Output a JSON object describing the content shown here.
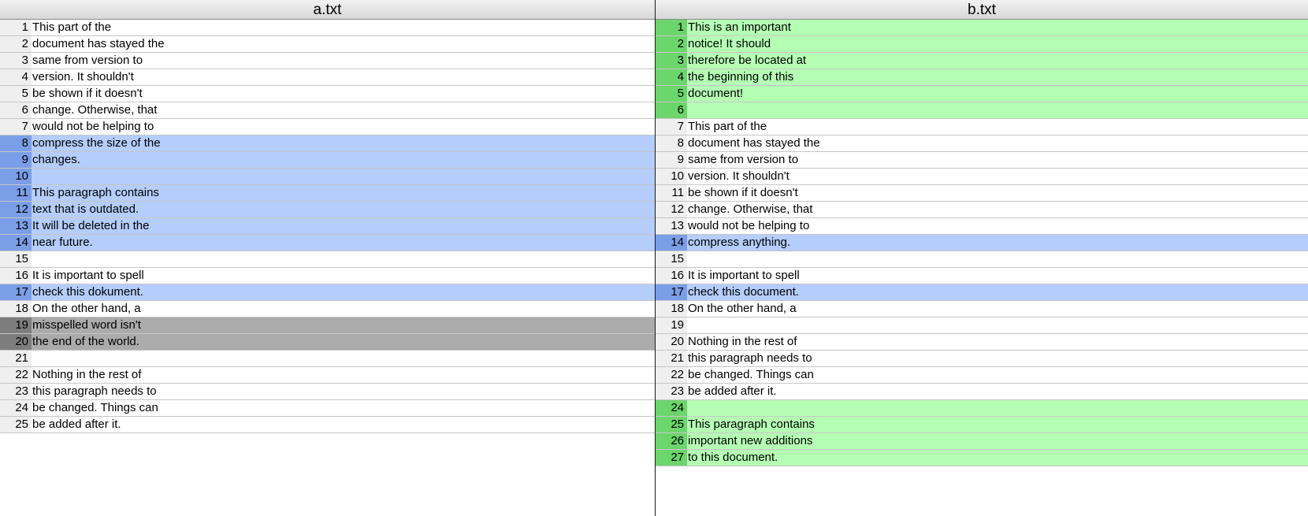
{
  "colors": {
    "changed_text_bg": "#b4cdfb",
    "changed_gutter_bg": "#7b9ee8",
    "added_text_bg": "#b5ffb5",
    "added_gutter_bg": "#6cd56c",
    "deleted_text_bg": "#ababab",
    "deleted_gutter_bg": "#7d7d7d",
    "gutter_bg": "#efefef"
  },
  "left": {
    "title": "a.txt",
    "lines": [
      {
        "n": "1",
        "text": "This part of the",
        "status": "same"
      },
      {
        "n": "2",
        "text": "document has stayed the",
        "status": "same"
      },
      {
        "n": "3",
        "text": "same from version to",
        "status": "same"
      },
      {
        "n": "4",
        "text": "version. It shouldn't",
        "status": "same"
      },
      {
        "n": "5",
        "text": "be shown if it doesn't",
        "status": "same"
      },
      {
        "n": "6",
        "text": "change. Otherwise, that",
        "status": "same"
      },
      {
        "n": "7",
        "text": "would not be helping to",
        "status": "same"
      },
      {
        "n": "8",
        "text": "compress the size of the",
        "status": "changed"
      },
      {
        "n": "9",
        "text": "changes.",
        "status": "changed"
      },
      {
        "n": "10",
        "text": "",
        "status": "changed"
      },
      {
        "n": "11",
        "text": "This paragraph contains",
        "status": "changed"
      },
      {
        "n": "12",
        "text": "text that is outdated.",
        "status": "changed"
      },
      {
        "n": "13",
        "text": "It will be deleted in the",
        "status": "changed"
      },
      {
        "n": "14",
        "text": "near future.",
        "status": "changed"
      },
      {
        "n": "15",
        "text": "",
        "status": "same"
      },
      {
        "n": "16",
        "text": "It is important to spell",
        "status": "same"
      },
      {
        "n": "17",
        "text": "check this dokument.",
        "status": "changed"
      },
      {
        "n": "18",
        "text": "On the other hand, a",
        "status": "same"
      },
      {
        "n": "19",
        "text": "misspelled word isn't",
        "status": "deleted"
      },
      {
        "n": "20",
        "text": "the end of the world.",
        "status": "deleted"
      },
      {
        "n": "21",
        "text": "",
        "status": "same"
      },
      {
        "n": "22",
        "text": "Nothing in the rest of",
        "status": "same"
      },
      {
        "n": "23",
        "text": "this paragraph needs to",
        "status": "same"
      },
      {
        "n": "24",
        "text": "be changed. Things can",
        "status": "same"
      },
      {
        "n": "25",
        "text": "be added after it.",
        "status": "same"
      }
    ]
  },
  "right": {
    "title": "b.txt",
    "lines": [
      {
        "n": "1",
        "text": "This is an important",
        "status": "added"
      },
      {
        "n": "2",
        "text": "notice! It should",
        "status": "added"
      },
      {
        "n": "3",
        "text": "therefore be located at",
        "status": "added"
      },
      {
        "n": "4",
        "text": "the beginning of this",
        "status": "added"
      },
      {
        "n": "5",
        "text": "document!",
        "status": "added"
      },
      {
        "n": "6",
        "text": "",
        "status": "added"
      },
      {
        "n": "7",
        "text": "This part of the",
        "status": "same"
      },
      {
        "n": "8",
        "text": "document has stayed the",
        "status": "same"
      },
      {
        "n": "9",
        "text": "same from version to",
        "status": "same"
      },
      {
        "n": "10",
        "text": "version. It shouldn't",
        "status": "same"
      },
      {
        "n": "11",
        "text": "be shown if it doesn't",
        "status": "same"
      },
      {
        "n": "12",
        "text": "change. Otherwise, that",
        "status": "same"
      },
      {
        "n": "13",
        "text": "would not be helping to",
        "status": "same"
      },
      {
        "n": "14",
        "text": "compress anything.",
        "status": "changed"
      },
      {
        "n": "15",
        "text": "",
        "status": "same"
      },
      {
        "n": "16",
        "text": "It is important to spell",
        "status": "same"
      },
      {
        "n": "17",
        "text": "check this document.",
        "status": "changed"
      },
      {
        "n": "18",
        "text": "On the other hand, a",
        "status": "same"
      },
      {
        "n": "19",
        "text": "",
        "status": "same"
      },
      {
        "n": "20",
        "text": "Nothing in the rest of",
        "status": "same"
      },
      {
        "n": "21",
        "text": "this paragraph needs to",
        "status": "same"
      },
      {
        "n": "22",
        "text": "be changed. Things can",
        "status": "same"
      },
      {
        "n": "23",
        "text": "be added after it.",
        "status": "same"
      },
      {
        "n": "24",
        "text": "",
        "status": "added"
      },
      {
        "n": "25",
        "text": "This paragraph contains",
        "status": "added"
      },
      {
        "n": "26",
        "text": "important new additions",
        "status": "added"
      },
      {
        "n": "27",
        "text": "to this document.",
        "status": "added"
      }
    ]
  }
}
